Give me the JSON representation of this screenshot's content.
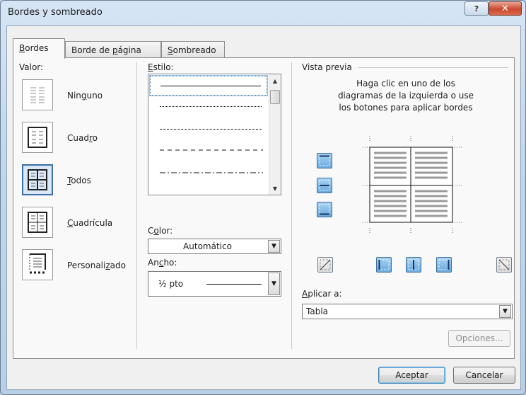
{
  "window": {
    "title": "Bordes y sombreado",
    "help_glyph": "?",
    "close_glyph": "✕"
  },
  "tabs": [
    {
      "label": "Bordes",
      "mnemonic": "B",
      "rest": "ordes",
      "active": true
    },
    {
      "label": "Borde de página",
      "prefix": "Borde de ",
      "mnemonic": "p",
      "rest": "ágina",
      "active": false
    },
    {
      "label": "Sombreado",
      "mnemonic": "S",
      "rest": "ombreado",
      "active": false
    }
  ],
  "valor": {
    "label": "Valor:",
    "presets": [
      {
        "label": "Ninguno",
        "pre": "Nin",
        "mn": "g",
        "post": "uno",
        "selected": false
      },
      {
        "label": "Cuadro",
        "pre": "Cuad",
        "mn": "r",
        "post": "o",
        "selected": false
      },
      {
        "label": "Todos",
        "pre": "",
        "mn": "T",
        "post": "odos",
        "selected": true
      },
      {
        "label": "Cuadrícula",
        "pre": "",
        "mn": "C",
        "post": "uadrícula",
        "selected": false
      },
      {
        "label": "Personalizado",
        "pre": "Personali",
        "mn": "z",
        "post": "ado",
        "selected": false
      }
    ]
  },
  "estilo": {
    "label": "Estilo:",
    "mn": "E",
    "rest": "stilo:",
    "styles": [
      "solid",
      "dotted",
      "dashed-fine",
      "dashed",
      "dash-dot"
    ]
  },
  "color": {
    "label": "Color:",
    "pre": "C",
    "mn": "o",
    "post": "lor:",
    "value": "Automático"
  },
  "ancho": {
    "label": "Ancho:",
    "pre": "An",
    "mn": "c",
    "post": "ho:",
    "value": "½ pto"
  },
  "preview": {
    "label": "Vista previa",
    "instructions": "Haga clic en uno de los diagramas de la izquierda o use los botones para aplicar bordes",
    "line1": "Haga clic en uno de los",
    "line2": "diagramas de la izquierda o use",
    "line3": "los botones para aplicar bordes"
  },
  "aplicar": {
    "label": "Aplicar a:",
    "mn": "A",
    "rest": "plicar a:",
    "value": "Tabla"
  },
  "buttons": {
    "opciones": "Opciones...",
    "aceptar": "Aceptar",
    "cancelar": "Cancelar"
  },
  "colors": {
    "accent": "#3c7fb1",
    "tool_on": "#6aa9dc",
    "frame": "#bcd2e8"
  }
}
